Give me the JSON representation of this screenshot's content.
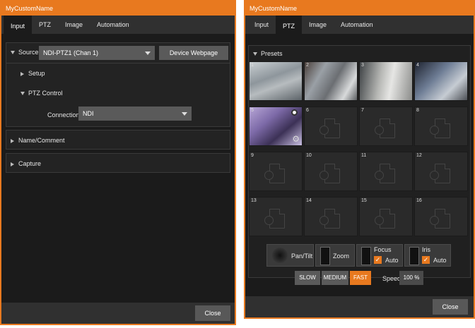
{
  "left_window": {
    "title": "MyCustomName",
    "tabs": [
      "Input",
      "PTZ",
      "Image",
      "Automation"
    ],
    "source_label": "Source",
    "source_value": "NDI-PTZ1 (Chan 1)",
    "device_webpage_label": "Device Webpage",
    "setup_label": "Setup",
    "ptz_control_label": "PTZ Control",
    "connection_label": "Connection",
    "connection_value": "NDI",
    "name_comment_label": "Name/Comment",
    "capture_label": "Capture",
    "close_label": "Close"
  },
  "right_window": {
    "title": "MyCustomName",
    "tabs": [
      "Input",
      "PTZ",
      "Image",
      "Automation"
    ],
    "presets_label": "Presets",
    "preset_numbers": [
      "1",
      "2",
      "3",
      "4",
      "5",
      "6",
      "7",
      "8",
      "9",
      "10",
      "11",
      "12",
      "13",
      "14",
      "15",
      "16"
    ],
    "pan_tilt_label": "Pan/Tilt",
    "zoom_label": "Zoom",
    "focus_label": "Focus",
    "iris_label": "Iris",
    "auto_label": "Auto",
    "slow_label": "SLOW",
    "medium_label": "MEDIUM",
    "fast_label": "FAST",
    "speed_label": "Speed",
    "speed_value": "100 %",
    "close_label": "Close"
  },
  "colors": {
    "accent": "#e8791f",
    "background": "#1b1b1b",
    "panel": "#232323"
  }
}
